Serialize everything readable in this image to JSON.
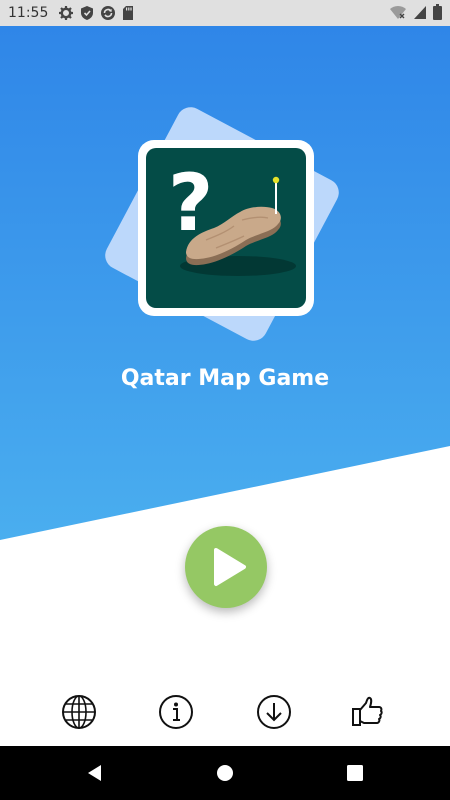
{
  "status_bar": {
    "time": "11:55",
    "left_icons": [
      "settings-icon",
      "shield-icon",
      "sync-icon",
      "sd-card-icon"
    ],
    "right_icons": [
      "wifi-icon",
      "signal-icon",
      "battery-icon"
    ]
  },
  "app": {
    "title": "Qatar Map Game",
    "logo_icon": "qatar-map-question-icon",
    "play_icon": "play-icon"
  },
  "toolbar": {
    "items": [
      {
        "icon": "globe-icon"
      },
      {
        "icon": "info-icon"
      },
      {
        "icon": "download-icon"
      },
      {
        "icon": "thumbs-up-icon"
      }
    ]
  },
  "nav_bar": {
    "items": [
      {
        "icon": "back-icon"
      },
      {
        "icon": "home-icon"
      },
      {
        "icon": "recents-icon"
      }
    ]
  },
  "colors": {
    "hero_top": "#2f86e8",
    "hero_bottom": "#4aa7ee",
    "logo_back": "#bcd8fb",
    "logo_inner": "#044c47",
    "play_button": "#95c864",
    "nav_bar": "#000000",
    "status_bar": "#e0e0e0"
  }
}
